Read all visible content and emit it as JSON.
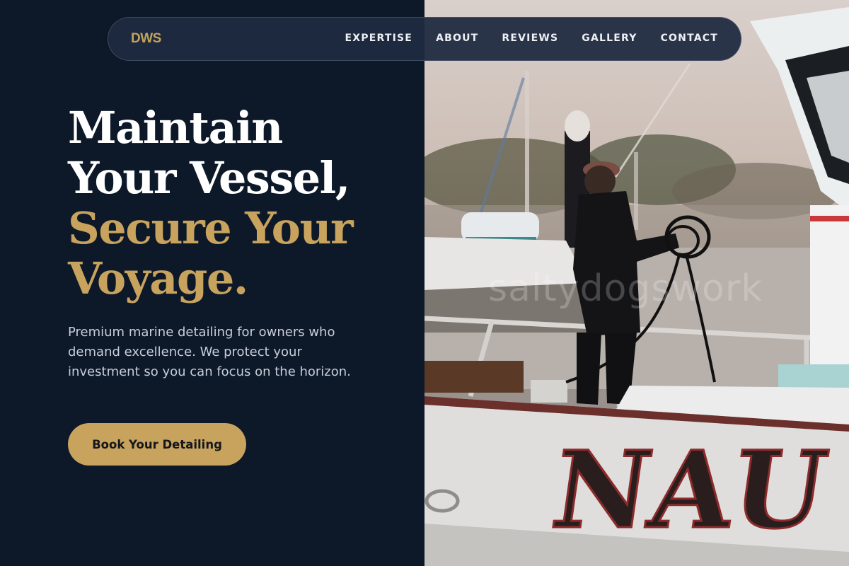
{
  "nav": {
    "logo": "DWS",
    "links": [
      "EXPERTISE",
      "ABOUT",
      "REVIEWS",
      "GALLERY",
      "CONTACT"
    ]
  },
  "hero": {
    "headline_white": [
      "Maintain",
      "Your Vessel,"
    ],
    "headline_gold": [
      "Secure Your",
      "Voyage."
    ],
    "description": "Premium marine detailing for owners who demand excellence. We protect your investment so you can focus on the horizon.",
    "cta_label": "Book Your Detailing"
  },
  "photo": {
    "watermark": "saltydogswork",
    "hull_lettering": "NAU"
  },
  "colors": {
    "background": "#0d1829",
    "accent_gold": "#c8a35e",
    "nav_bg": "#1e2a40",
    "text_light": "#c9ced8"
  }
}
